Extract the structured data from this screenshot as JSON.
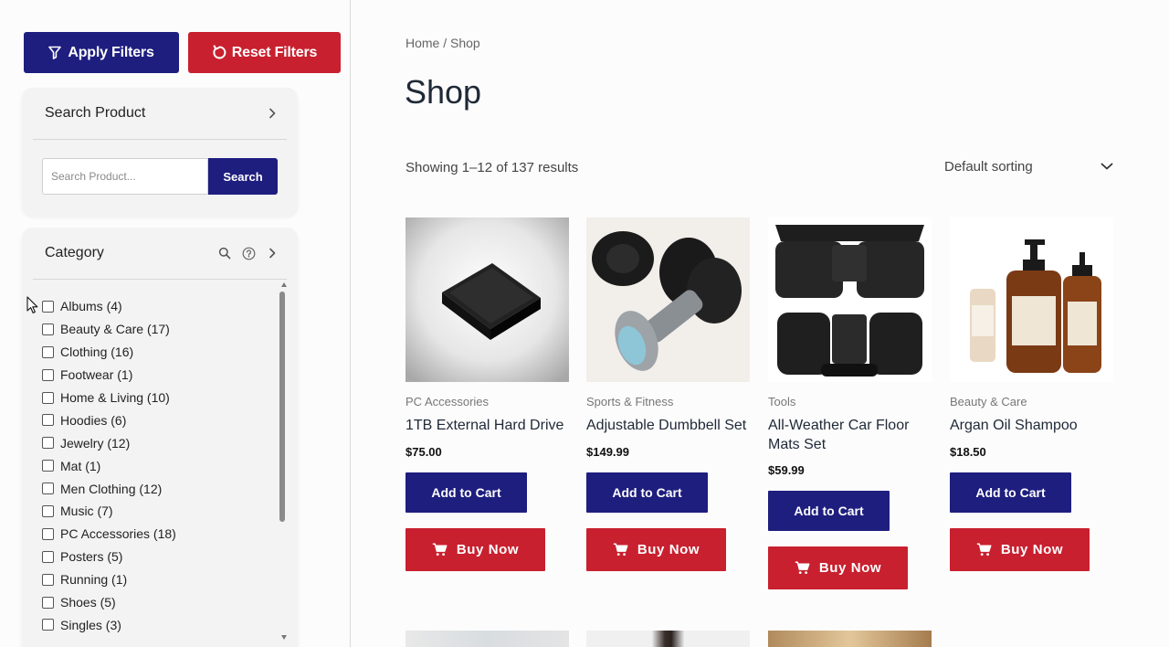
{
  "sidebar": {
    "apply_label": "Apply Filters",
    "reset_label": "Reset Filters",
    "search_panel": {
      "title": "Search Product",
      "placeholder": "Search Product...",
      "button_label": "Search"
    },
    "category_panel": {
      "title": "Category",
      "items": [
        {
          "label": "Albums (4)"
        },
        {
          "label": "Beauty & Care (17)"
        },
        {
          "label": "Clothing (16)"
        },
        {
          "label": "Footwear (1)"
        },
        {
          "label": "Home & Living (10)"
        },
        {
          "label": "Hoodies (6)"
        },
        {
          "label": "Jewelry (12)"
        },
        {
          "label": "Mat (1)"
        },
        {
          "label": "Men Clothing (12)"
        },
        {
          "label": "Music (7)"
        },
        {
          "label": "PC Accessories (18)"
        },
        {
          "label": "Posters (5)"
        },
        {
          "label": "Running (1)"
        },
        {
          "label": "Shoes (5)"
        },
        {
          "label": "Singles (3)"
        }
      ]
    }
  },
  "main": {
    "breadcrumb": "Home / Shop",
    "title": "Shop",
    "result_count": "Showing 1–12 of 137 results",
    "sorting": "Default sorting",
    "products": [
      {
        "category": "PC Accessories",
        "name": "1TB External Hard Drive",
        "price": "$75.00",
        "cart_label": "Add to Cart",
        "buy_label": "Buy Now"
      },
      {
        "category": "Sports & Fitness",
        "name": "Adjustable Dumbbell Set",
        "price": "$149.99",
        "cart_label": "Add to Cart",
        "buy_label": "Buy Now"
      },
      {
        "category": "Tools",
        "name": "All-Weather Car Floor Mats Set",
        "price": "$59.99",
        "cart_label": "Add to Cart",
        "buy_label": "Buy Now"
      },
      {
        "category": "Beauty & Care",
        "name": "Argan Oil Shampoo",
        "price": "$18.50",
        "cart_label": "Add to Cart",
        "buy_label": "Buy Now"
      }
    ]
  },
  "colors": {
    "primary": "#1e1e7f",
    "danger": "#c8202f"
  }
}
